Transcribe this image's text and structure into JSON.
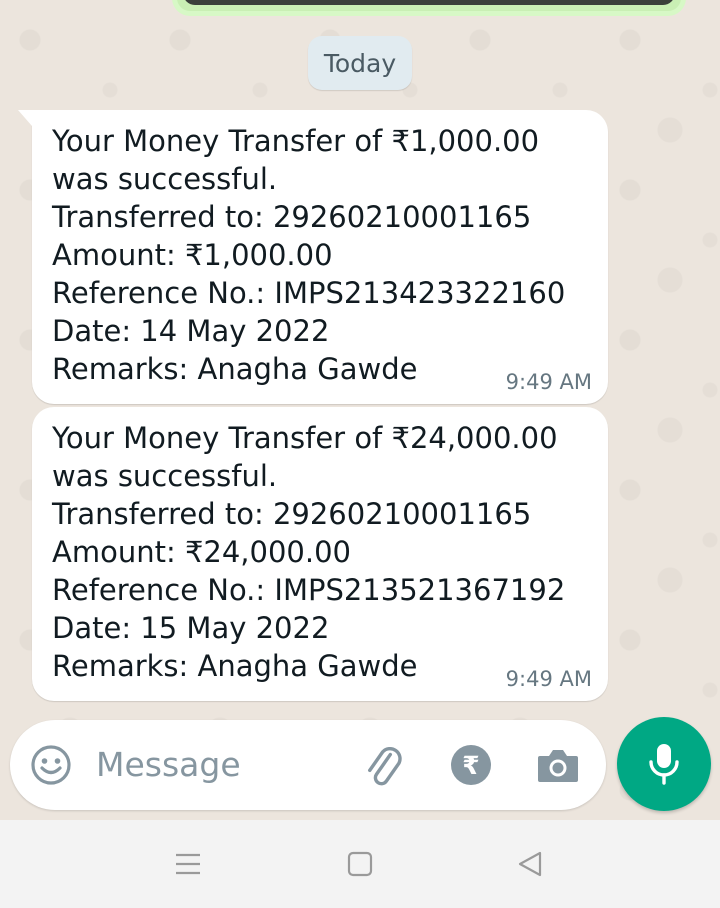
{
  "chat": {
    "date_separator": "Today",
    "messages": [
      {
        "lines": [
          "Your Money Transfer of ₹1,000.00",
          "was successful.",
          "Transferred to: 29260210001165",
          "Amount: ₹1,000.00",
          "Reference No.: IMPS213423322160",
          "Date: 14 May 2022",
          "Remarks: Anagha Gawde"
        ],
        "time": "9:49 AM"
      },
      {
        "lines": [
          "Your Money Transfer of ₹24,000.00",
          "was successful.",
          "Transferred to: 29260210001165",
          "Amount: ₹24,000.00",
          "Reference No.: IMPS213521367192",
          "Date: 15 May 2022",
          "Remarks: Anagha Gawde"
        ],
        "time": "9:49 AM"
      }
    ]
  },
  "composer": {
    "placeholder": "Message",
    "icons": [
      "emoji-icon",
      "attach-icon",
      "rupee-payment-icon",
      "camera-icon",
      "mic-icon"
    ]
  },
  "navbar": {
    "icons": [
      "menu-icon",
      "home-icon",
      "back-icon"
    ]
  },
  "colors": {
    "accent": "#00a884",
    "bubble": "#ffffff",
    "wallpaper": "#ece5dd"
  }
}
